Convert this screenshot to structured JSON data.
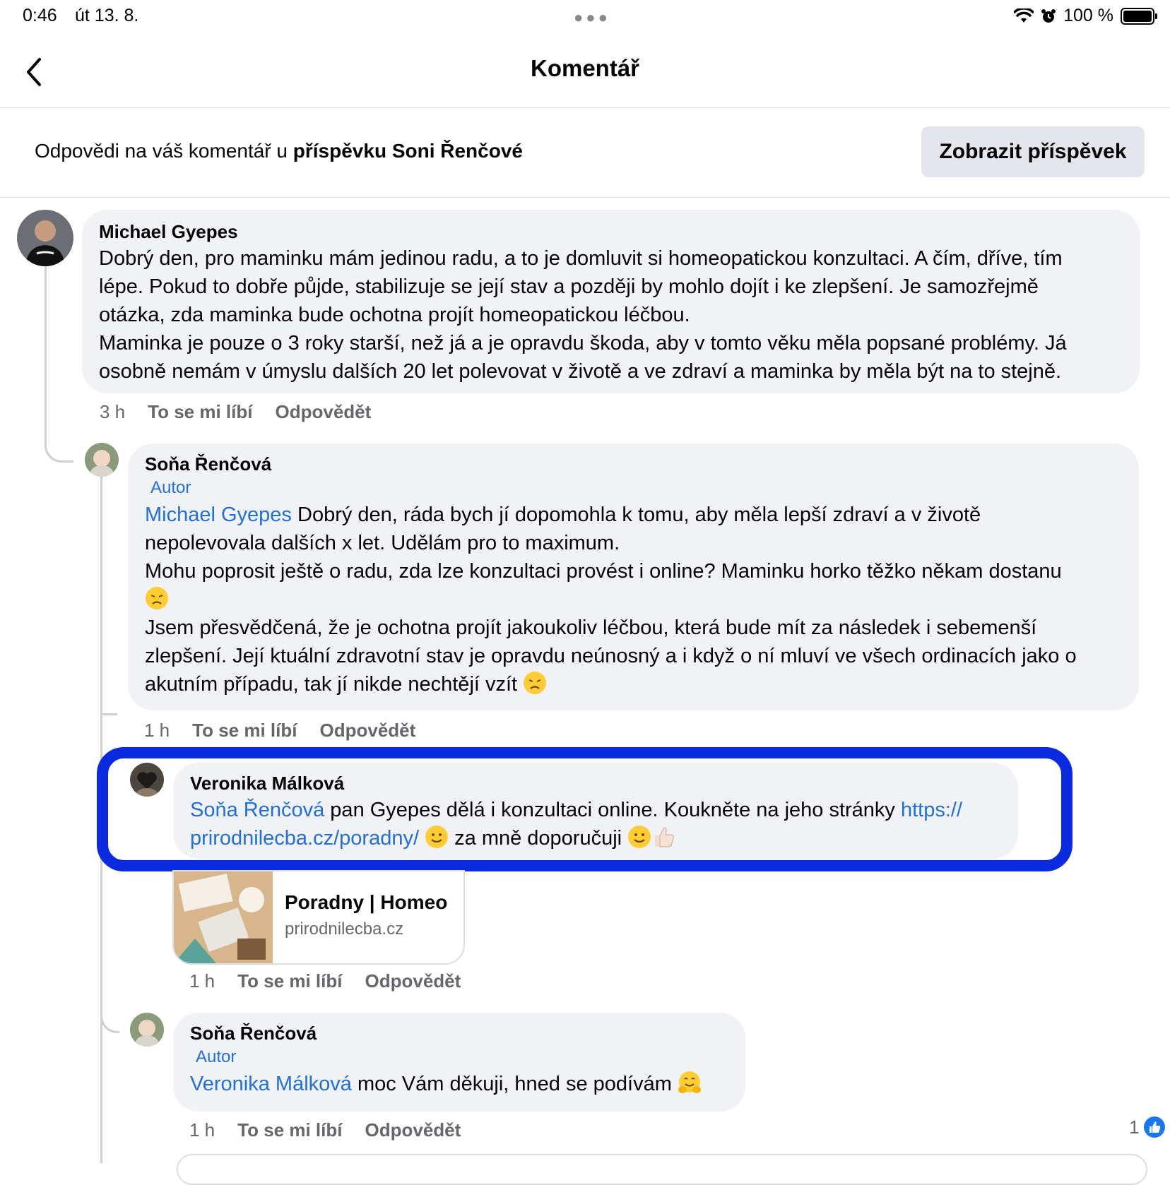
{
  "status_bar": {
    "time": "0:46",
    "date": "út 13. 8.",
    "battery": "100 %"
  },
  "nav": {
    "title": "Komentář"
  },
  "context": {
    "prefix": "Odpovědi na váš komentář u ",
    "bold": "příspěvku Soni Řenčové",
    "view_post_button": "Zobrazit příspěvek"
  },
  "comments": [
    {
      "author": "Michael Gyepes",
      "lines": [
        "Dobrý den, pro maminku mám jedinou radu, a to je domluvit si homeopatickou konzultaci. A čím, dříve, tím",
        "lépe. Pokud to dobře půjde, stabilizuje se její stav a později by mohlo dojít i ke zlepšení. Je samozřejmě",
        "otázka, zda maminka bude ochotna projít homeopatickou léčbou.",
        "Maminka je pouze o 3 roky starší, než já a je opravdu škoda, aby v tomto věku měla popsané problémy. Já",
        "osobně nemám v úmyslu dalších 20 let polevovat v životě a ve zdraví a maminka by měla být na to stejně."
      ],
      "time": "3 h",
      "like": "To se mi líbí",
      "reply": "Odpovědět"
    },
    {
      "author": "Soňa Řenčová",
      "badge": "Autor",
      "mention": "Michael Gyepes",
      "line1_rest": " Dobrý den, ráda bych jí dopomohla k tomu, aby měla lepší zdraví a v životě",
      "lines": [
        "nepolevovala dalších x let. Udělám pro to maximum.",
        "Mohu poprosit ještě o radu, zda lze konzultaci provést i online? Maminku horko těžko někam dostanu",
        "",
        "Jsem přesvědčená, že je ochotna projít jakoukoliv léčbou, která bude mít za následek i sebemenší",
        "zlepšení. Její ktuální zdravotní stav je opravdu neúnosný a i když o ní mluví ve všech ordinacích jako o"
      ],
      "last_line": "akutním případu, tak jí nikde nechtějí vzít ",
      "time": "1 h",
      "like": "To se mi líbí",
      "reply": "Odpovědět"
    },
    {
      "author": "Veronika Málková",
      "mention": "Soňa Řenčová",
      "line1_rest": " pan Gyepes dělá i konzultaci online. Koukněte na jeho stránky ",
      "link_part1": "https://",
      "link_part2": "prirodnilecba.cz/poradny/",
      "line2_rest": " za mně doporučuji ",
      "card": {
        "title": "Poradny | Homeo",
        "domain": "prirodnilecba.cz"
      },
      "time": "1 h",
      "like": "To se mi líbí",
      "reply": "Odpovědět"
    },
    {
      "author": "Soňa Řenčová",
      "badge": "Autor",
      "mention": "Veronika Málková",
      "rest": " moc Vám děkuji, hned se podívám ",
      "time": "1 h",
      "like": "To se mi líbí",
      "reply": "Odpovědět",
      "reaction_count": "1"
    }
  ],
  "colors": {
    "highlight": "#0a2ae0",
    "mention": "#216fdb",
    "bubble": "#f0f2f5"
  }
}
